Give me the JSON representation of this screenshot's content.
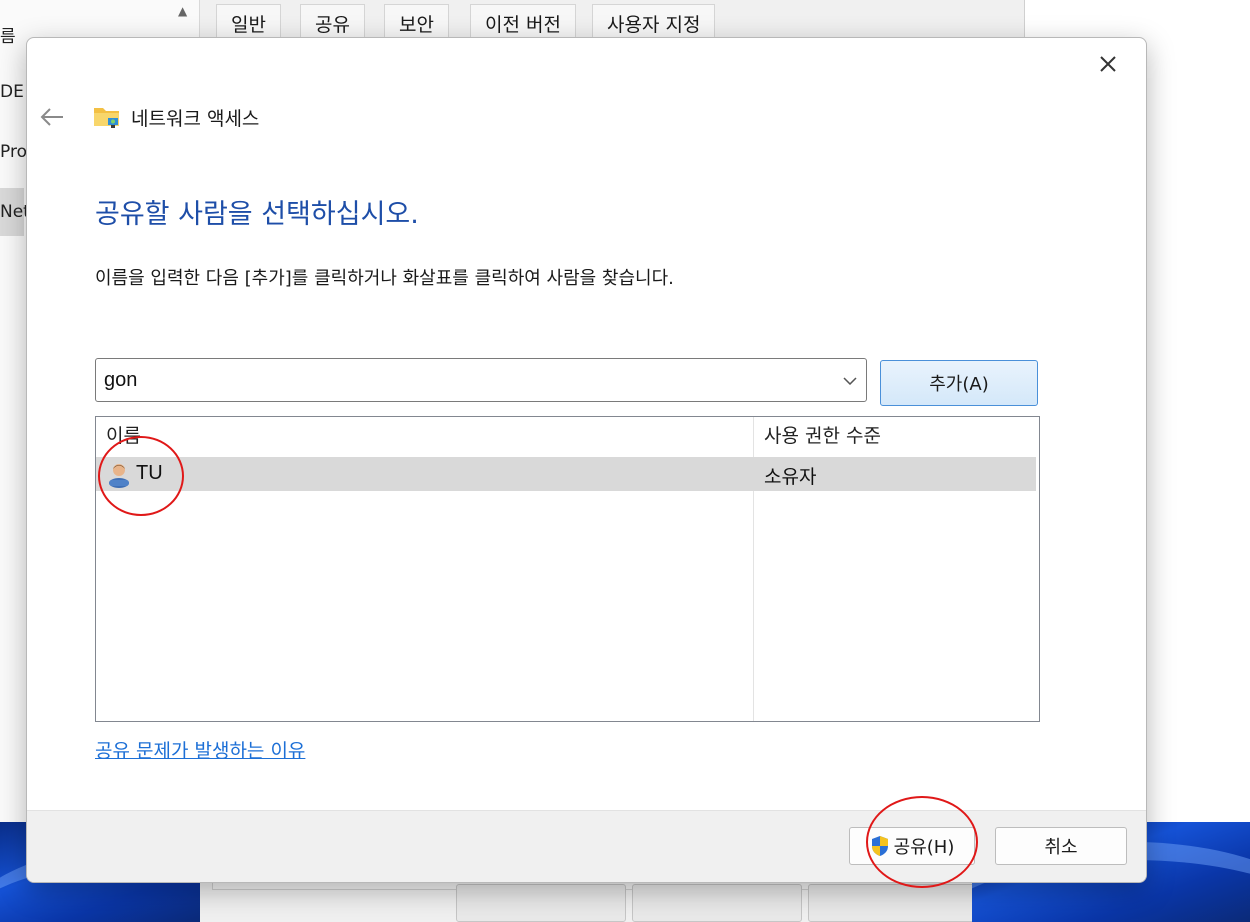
{
  "background": {
    "left_pane_items": [
      "름",
      "DE",
      "Pro",
      "Net"
    ],
    "property_tabs": [
      "일반",
      "공유",
      "보안",
      "이전 버전",
      "사용자 지정"
    ]
  },
  "dialog": {
    "title": "네트워크 액세스",
    "heading": "공유할 사람을 선택하십시오.",
    "instruction": "이름을 입력한 다음 [추가]를 클릭하거나 화살표를 클릭하여 사람을 찾습니다.",
    "name_combo_value": "gon",
    "add_button": "추가(A)",
    "columns": {
      "name": "이름",
      "permission": "사용 권한 수준"
    },
    "rows": [
      {
        "name": "TU",
        "permission": "소유자"
      }
    ],
    "help_link": "공유 문제가 발생하는 이유",
    "share_button": "공유(H)",
    "cancel_button": "취소"
  },
  "icons": {
    "close": "close-icon",
    "back": "back-arrow-icon",
    "title": "network-folder-icon",
    "combo": "chevron-down-icon",
    "user": "user-icon",
    "shield": "uac-shield-icon"
  },
  "colors": {
    "heading": "#1e4ea8",
    "link": "#1c6fd6",
    "selected_row": "#d9d9d9",
    "annotation": "#e01818"
  }
}
